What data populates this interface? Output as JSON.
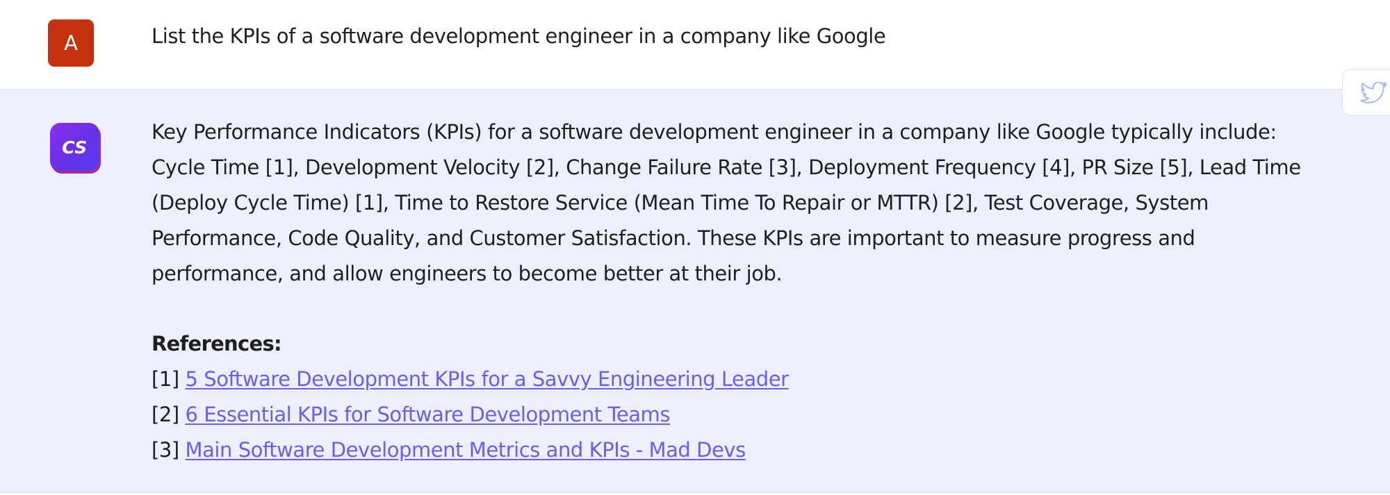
{
  "user_message": {
    "avatar_letter": "A",
    "avatar_color": "#c4310f",
    "text": "List the KPIs of a software development engineer in a company like Google"
  },
  "assistant_message": {
    "avatar_label": "CS",
    "answer_lines": [
      "Key Performance Indicators (KPIs) for a software development engineer in a company like Google typically include:",
      "Cycle Time [1], Development Velocity [2], Change Failure Rate [3], Deployment Frequency [4], PR Size [5], Lead Time",
      "(Deploy Cycle Time) [1], Time to Restore Service (Mean Time To Repair or MTTR) [2], Test Coverage, System",
      "Performance, Code Quality, and Customer Satisfaction. These KPIs are important to measure progress and",
      "performance, and allow engineers to become better at their job."
    ],
    "references_heading": "References:",
    "references": [
      {
        "marker": "[1]",
        "title": "5 Software Development KPIs for a Savvy Engineering Leader"
      },
      {
        "marker": "[2]",
        "title": "6 Essential KPIs for Software Development Teams"
      },
      {
        "marker": "[3]",
        "title": "Main Software Development Metrics and KPIs - Mad Devs"
      }
    ]
  },
  "share": {
    "icon": "twitter-icon"
  },
  "colors": {
    "assistant_background": "#edf0fc",
    "link": "#6a5ef0",
    "share_icon": "#aab8f7"
  }
}
